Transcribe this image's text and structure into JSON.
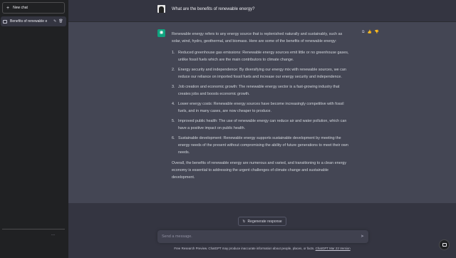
{
  "sidebar": {
    "new_chat_label": "New chat",
    "conversation_title": "Benefits of renewable e",
    "more_label": "..."
  },
  "chat": {
    "user_message": "What are the benefits of renewable energy?",
    "assistant_intro": "Renewable energy refers to any energy source that is replenished naturally and sustainably, such as solar, wind, hydro, geothermal, and biomass. Here are some of the benefits of renewable energy:",
    "benefits": [
      {
        "num": "1.",
        "text": "Reduced greenhouse gas emissions: Renewable energy sources emit little or no greenhouse gases, unlike fossil fuels which are the main contributors to climate change."
      },
      {
        "num": "2.",
        "text": "Energy security and independence: By diversifying our energy mix with renewable sources, we can reduce our reliance on imported fossil fuels and increase our energy security and independence."
      },
      {
        "num": "3.",
        "text": "Job creation and economic growth: The renewable energy sector is a fast-growing industry that creates jobs and boosts economic growth."
      },
      {
        "num": "4.",
        "text": "Lower energy costs: Renewable energy sources have become increasingly competitive with fossil fuels, and in many cases, are now cheaper to produce."
      },
      {
        "num": "5.",
        "text": "Improved public health: The use of renewable energy can reduce air and water pollution, which can have a positive impact on public health."
      },
      {
        "num": "6.",
        "text": "Sustainable development: Renewable energy supports sustainable development by meeting the energy needs of the present without compromising the ability of future generations to meet their own needs."
      }
    ],
    "assistant_outro": "Overall, the benefits of renewable energy are numerous and varied, and transitioning to a clean energy economy is essential to addressing the urgent challenges of climate change and sustainable development."
  },
  "composer": {
    "regenerate_label": "Regenerate response",
    "placeholder": "Send a message."
  },
  "footer": {
    "disclaimer": "Free Research Preview. ChatGPT may produce inaccurate information about people, places, or facts.",
    "version_link": "ChatGPT Mar 23 Version"
  },
  "colors": {
    "sidebar_bg": "#202123",
    "main_bg": "#343541",
    "assistant_bg": "#444654",
    "brand": "#10a37f"
  },
  "icons": [
    "plus-icon",
    "chat-bubble-icon",
    "edit-icon",
    "trash-icon",
    "openai-logo-icon",
    "copy-icon",
    "thumbs-up-icon",
    "thumbs-down-icon",
    "refresh-icon",
    "send-icon",
    "help-icon"
  ]
}
